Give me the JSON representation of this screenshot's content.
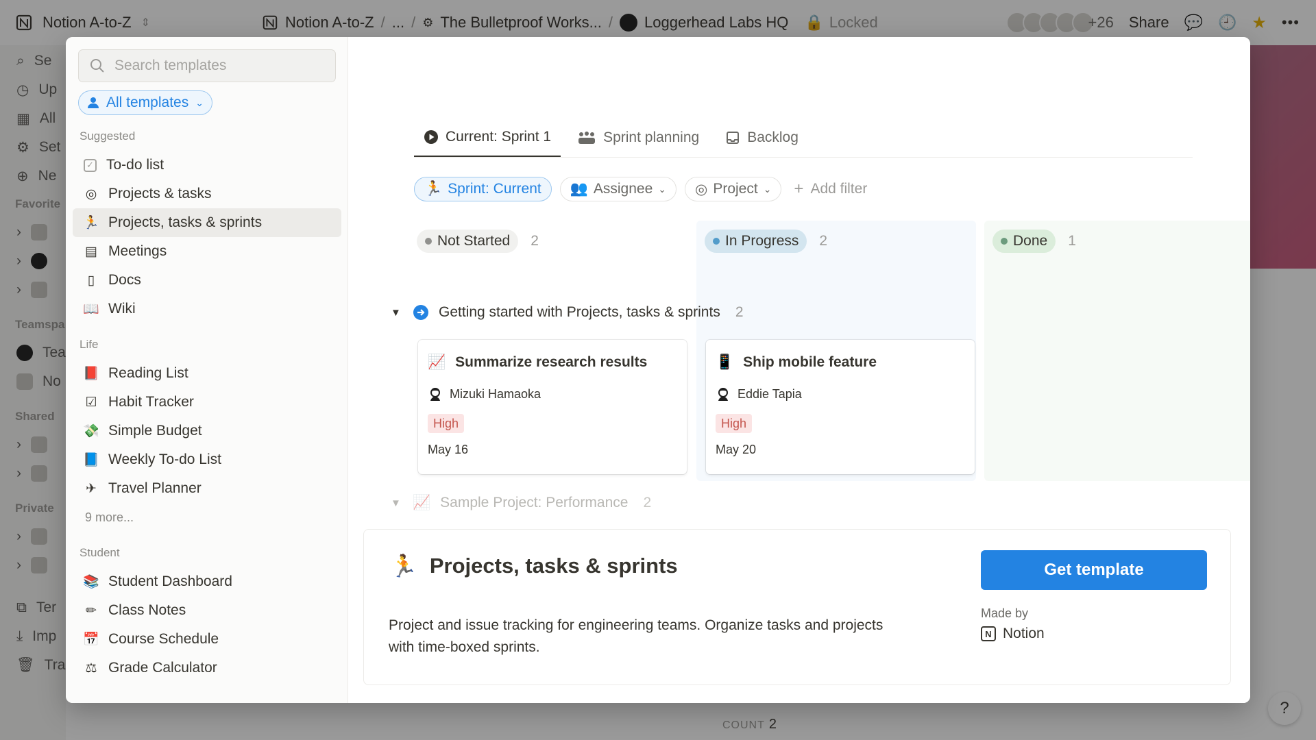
{
  "topbar": {
    "workspace": "Notion A-to-Z",
    "breadcrumbs": [
      "Notion A-to-Z",
      "...",
      "The Bulletproof Works...",
      "Loggerhead Labs HQ"
    ],
    "locked_label": "Locked",
    "extra_members": "+26",
    "share_label": "Share"
  },
  "bg_sidebar": {
    "items": [
      "Se",
      "Up",
      "All",
      "Set",
      "Ne"
    ],
    "favorites_label": "Favorite",
    "teamspaces_label": "Teamspa",
    "team_items": [
      "Tea",
      "No"
    ],
    "shared_label": "Shared",
    "private_label": "Private",
    "bottom_items": [
      "Ter",
      "Imp",
      "Trash"
    ]
  },
  "page_footer": {
    "count_label": "COUNT",
    "count_value": "2",
    "help": "?"
  },
  "modal": {
    "search_placeholder": "Search templates",
    "filter_label": "All templates",
    "groups": [
      {
        "title": "Suggested",
        "items": [
          {
            "label": "To-do list",
            "icon": "checkbox-icon",
            "glyph": "✓"
          },
          {
            "label": "Projects & tasks",
            "icon": "target-icon",
            "glyph": "◎"
          },
          {
            "label": "Projects, tasks & sprints",
            "icon": "runner-icon",
            "glyph": "🏃"
          },
          {
            "label": "Meetings",
            "icon": "calendar-icon",
            "glyph": "▤"
          },
          {
            "label": "Docs",
            "icon": "document-icon",
            "glyph": "▯"
          },
          {
            "label": "Wiki",
            "icon": "book-icon",
            "glyph": "📖"
          }
        ]
      },
      {
        "title": "Life",
        "items": [
          {
            "label": "Reading List",
            "icon": "book-stack-icon",
            "glyph": "📕"
          },
          {
            "label": "Habit Tracker",
            "icon": "checked-box-icon",
            "glyph": "☑"
          },
          {
            "label": "Simple Budget",
            "icon": "money-icon",
            "glyph": "💸"
          },
          {
            "label": "Weekly To-do List",
            "icon": "blue-book-icon",
            "glyph": "📘"
          },
          {
            "label": "Travel Planner",
            "icon": "airplane-icon",
            "glyph": "✈"
          }
        ],
        "more": "9 more..."
      },
      {
        "title": "Student",
        "items": [
          {
            "label": "Student Dashboard",
            "icon": "books-icon",
            "glyph": "📚"
          },
          {
            "label": "Class Notes",
            "icon": "pencil-icon",
            "glyph": "✏"
          },
          {
            "label": "Course Schedule",
            "icon": "calendar-page-icon",
            "glyph": "📅"
          },
          {
            "label": "Grade Calculator",
            "icon": "scales-icon",
            "glyph": "⚖"
          }
        ]
      }
    ],
    "selected_index": "Projects, tasks & sprints"
  },
  "preview": {
    "tabs": [
      {
        "label": "Current: Sprint 1",
        "icon": "play-circle-icon"
      },
      {
        "label": "Sprint planning",
        "icon": "team-icon"
      },
      {
        "label": "Backlog",
        "icon": "inbox-icon"
      }
    ],
    "filters": {
      "sprint": "Sprint: Current",
      "assignee": "Assignee",
      "project": "Project",
      "add": "Add filter"
    },
    "columns": [
      {
        "label": "Not Started",
        "count": "2",
        "dot": "#91918e",
        "bg": "#f1f1ef"
      },
      {
        "label": "In Progress",
        "count": "2",
        "dot": "#529cca",
        "bg": "#d3e5ef"
      },
      {
        "label": "Done",
        "count": "1",
        "dot": "#6c9b7d",
        "bg": "#dbeddb"
      }
    ],
    "group1": {
      "title": "Getting started with Projects, tasks & sprints",
      "count": "2"
    },
    "cards": [
      {
        "title": "Summarize research results",
        "icon": "chart-icon",
        "glyph": "📈",
        "assignee": "Mizuki Hamaoka",
        "priority": "High",
        "date": "May 16"
      },
      {
        "title": "Ship mobile feature",
        "icon": "phone-icon",
        "glyph": "📱",
        "assignee": "Eddie Tapia",
        "priority": "High",
        "date": "May 20"
      }
    ],
    "group2": {
      "title": "Sample Project: Performance",
      "count": "2"
    }
  },
  "info": {
    "title": "Projects, tasks & sprints",
    "description": "Project and issue tracking for engineering teams. Organize tasks and projects with time-boxed sprints.",
    "button": "Get template",
    "made_by_label": "Made by",
    "author": "Notion"
  },
  "colors": {
    "accent": "#2383e2",
    "priority_bg": "#fbe4e4",
    "priority_text": "#c4554d"
  }
}
